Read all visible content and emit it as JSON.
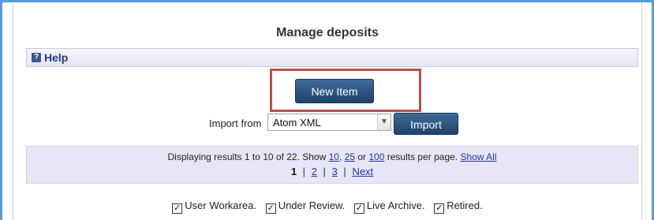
{
  "page": {
    "title": "Manage deposits"
  },
  "help": {
    "icon": "help-icon",
    "icon_glyph": "?",
    "label": "Help"
  },
  "actions": {
    "new_item_label": "New Item"
  },
  "import": {
    "label": "Import from",
    "selected_format": "Atom XML",
    "button_label": "Import"
  },
  "results": {
    "summary_prefix": "Displaying results 1 to 10 of 22. Show",
    "page_size_options": [
      "10",
      "25",
      "100"
    ],
    "or_text": "or",
    "summary_suffix": "results per page.",
    "show_all": "Show All",
    "pages": [
      "1",
      "2",
      "3"
    ],
    "current_page": "1",
    "next_label": "Next"
  },
  "filters": [
    {
      "label": "User Workarea.",
      "checked": true
    },
    {
      "label": "Under Review.",
      "checked": true
    },
    {
      "label": "Live Archive.",
      "checked": true
    },
    {
      "label": "Retired.",
      "checked": true
    }
  ],
  "colors": {
    "button": "#2c5580",
    "highlight": "#b8504d",
    "link": "#2233aa",
    "help_title": "#23398a",
    "results_bg": "#e6e6f6"
  }
}
